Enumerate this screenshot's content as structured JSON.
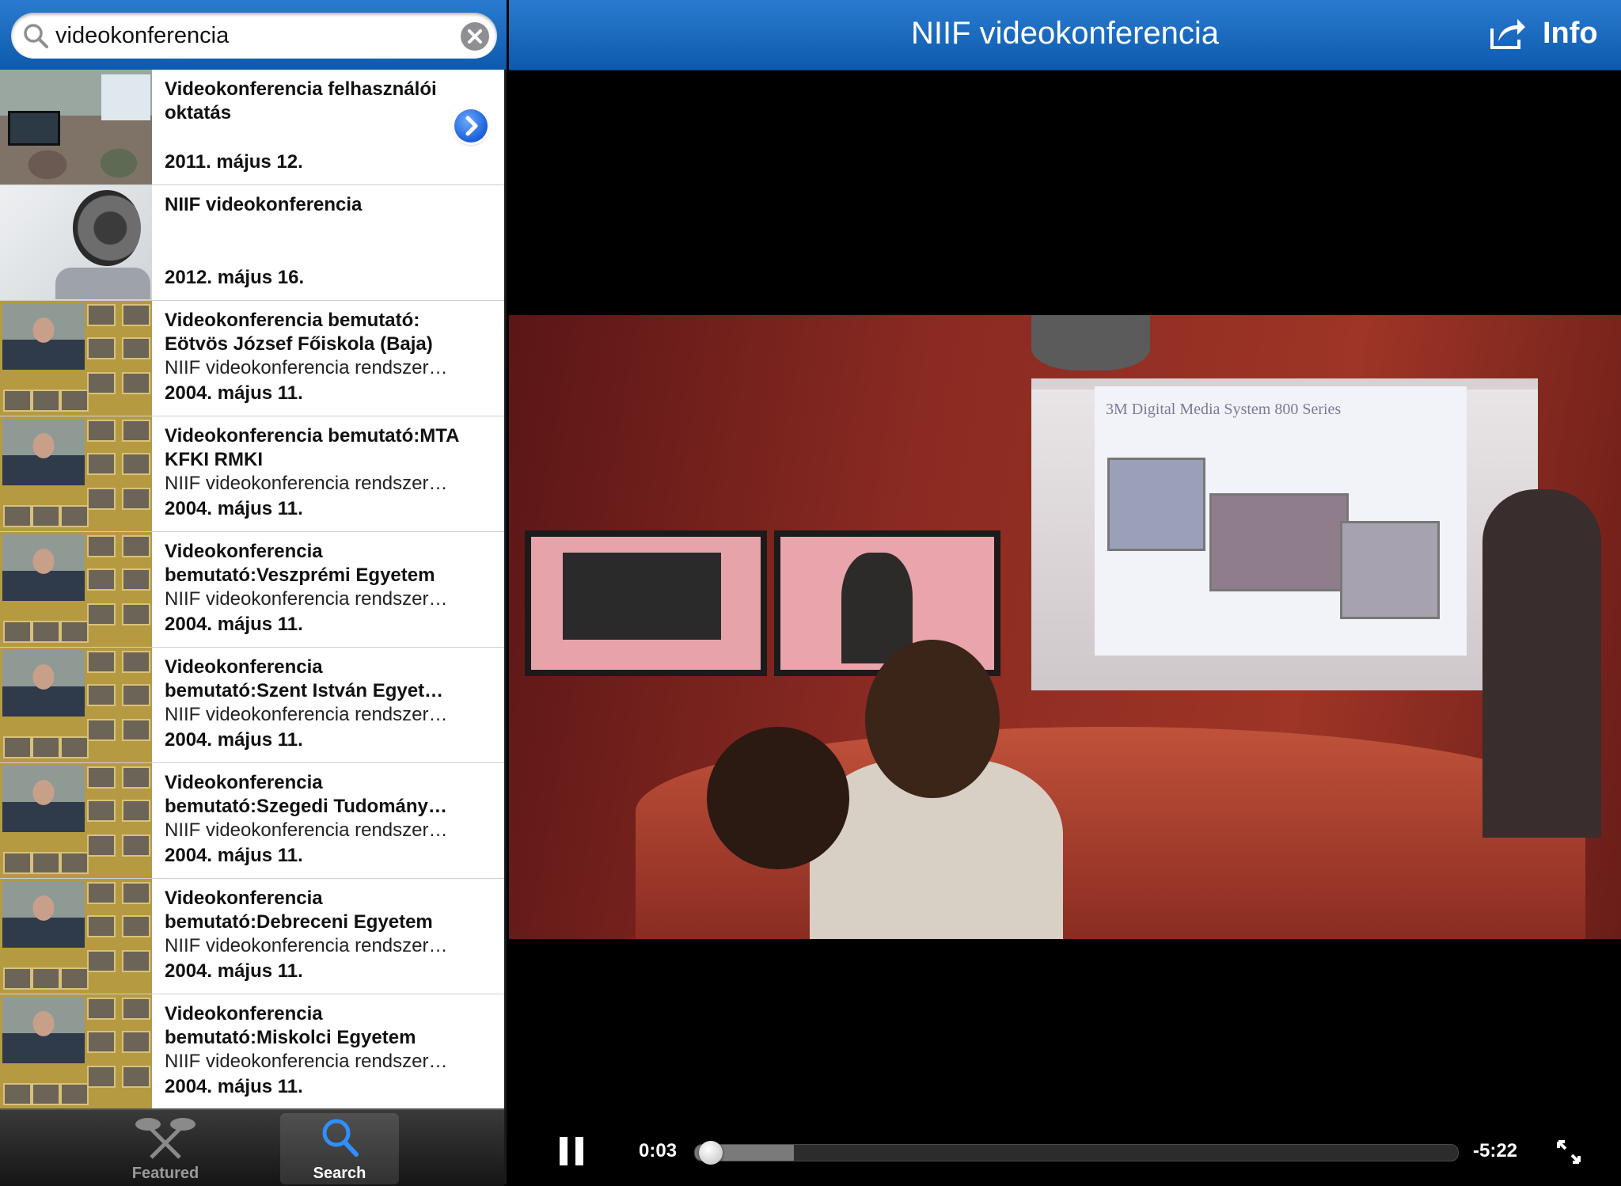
{
  "search": {
    "query": "videokonferencia"
  },
  "results": [
    {
      "title": "Videokonferencia felhasználói oktatás",
      "desc": "",
      "date": "2011. május 12.",
      "thumb": "room",
      "has_disclosure": true
    },
    {
      "title": "NIIF videokonferencia",
      "desc": "",
      "date": "2012. május 16.",
      "thumb": "camera"
    },
    {
      "title": "Videokonferencia bemutató: Eötvös József Főiskola (Baja)",
      "desc": "NIIF videokonferencia rendszer…",
      "date": "2004. május 11.",
      "thumb": "grid"
    },
    {
      "title": "Videokonferencia bemutató:MTA KFKI RMKI",
      "desc": "NIIF videokonferencia rendszer…",
      "date": "2004. május 11.",
      "thumb": "grid"
    },
    {
      "title": "Videokonferencia bemutató:Veszprémi Egyetem",
      "desc": "NIIF videokonferencia rendszer…",
      "date": "2004. május 11.",
      "thumb": "grid"
    },
    {
      "title": "Videokonferencia bemutató:Szent István Egyet…",
      "desc": "NIIF videokonferencia rendszer…",
      "date": "2004. május 11.",
      "thumb": "grid"
    },
    {
      "title": "Videokonferencia bemutató:Szegedi Tudomány…",
      "desc": "NIIF videokonferencia rendszer…",
      "date": "2004. május 11.",
      "thumb": "grid"
    },
    {
      "title": "Videokonferencia bemutató:Debreceni Egyetem",
      "desc": "NIIF videokonferencia rendszer…",
      "date": "2004. május 11.",
      "thumb": "grid"
    },
    {
      "title": "Videokonferencia bemutató:Miskolci Egyetem",
      "desc": "NIIF videokonferencia rendszer…",
      "date": "2004. május 11.",
      "thumb": "grid"
    }
  ],
  "tabs": {
    "featured": "Featured",
    "search": "Search",
    "active": "search"
  },
  "navbar": {
    "title": "NIIF videokonferencia",
    "info": "Info"
  },
  "player": {
    "state": "playing",
    "elapsed": "0:03",
    "remaining": "-5:22",
    "progress": 0.01,
    "buffered": 0.13
  },
  "video_frame": {
    "slide_text": "3M Digital Media System 800 Series"
  },
  "colors": {
    "nav_blue": "#1a6cc4",
    "accent_blue": "#1a5fd8"
  },
  "icons": {
    "search": "search-icon",
    "clear": "clear-icon",
    "disclosure": "chevron-right-icon",
    "featured": "featured-icon",
    "share": "share-icon",
    "pause": "pause-icon",
    "expand": "expand-icon"
  }
}
